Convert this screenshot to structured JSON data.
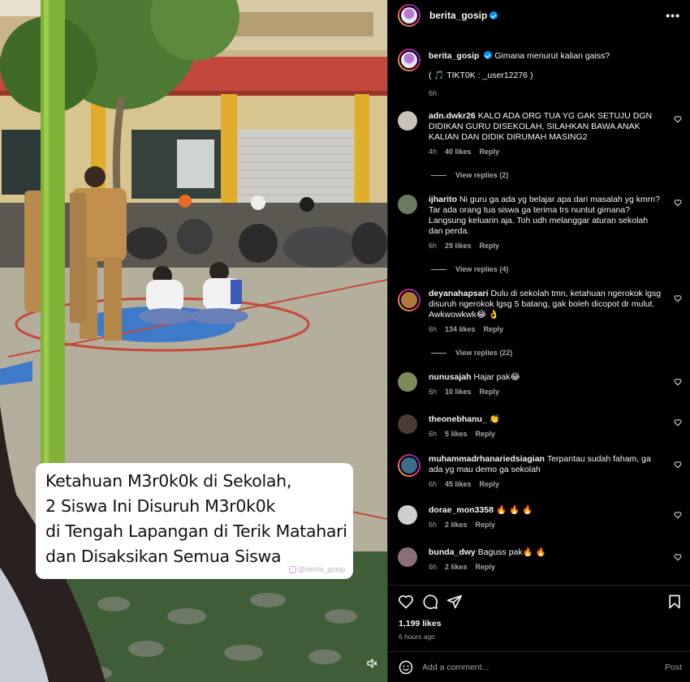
{
  "media": {
    "caption_lines": [
      "Ketahuan M3r0k0k di Sekolah,",
      "2 Siswa Ini Disuruh M3r0k0k",
      "di Tengah Lapangan di Terik Matahari",
      "dan Disaksikan Semua Siswa"
    ],
    "watermark": "@berita_gosip",
    "mute_icon": "speaker-muted-icon"
  },
  "post": {
    "username": "berita_gosip",
    "verified": true,
    "caption_user": "berita_gosip",
    "caption_text": "Gimana menurut kalian gaiss?",
    "caption_credit": "( 🎵 TIKT0K : _user12276 )",
    "caption_time": "6h",
    "more_icon": "more-options-icon"
  },
  "comments": [
    {
      "user": "adn.dwkr26",
      "text": "KALO ADA ORG TUA YG GAK SETUJU DGN DIDIKAN GURU DISEKOLAH, SILAHKAN BAWA ANAK KALIAN DAN DIDIK DIRUMAH MASING2",
      "time": "4h",
      "likes": "40 likes",
      "reply": "Reply",
      "view_replies": "View replies (2)",
      "avatar_color": "#c9c2b8"
    },
    {
      "user": "ijharito",
      "text": "Ni guru ga ada yg belajar apa dari masalah yg kmrn? Tar ada orang tua siswa ga terima trs nuntut gimana? Langsung keluarin aja. Toh udh melanggar aturan sekolah dan perda.",
      "time": "6h",
      "likes": "29 likes",
      "reply": "Reply",
      "view_replies": "View replies (4)",
      "avatar_color": "#6b7a5e"
    },
    {
      "user": "deyanahapsari",
      "text": "Dulu di sekolah tmn, ketahuan ngerokok lgsg disuruh ngerokok lgsg 5 batang, gak boleh dicopot dr mulut. Awkwowkwk😂 👌",
      "time": "6h",
      "likes": "134 likes",
      "reply": "Reply",
      "view_replies": "View replies (22)",
      "avatar_color": "#b07a3c"
    },
    {
      "user": "nunusajah",
      "text": "Hajar pak😂",
      "time": "6h",
      "likes": "10 likes",
      "reply": "Reply",
      "view_replies": "",
      "avatar_color": "#7d8a5a"
    },
    {
      "user": "theonebhanu_",
      "text": "👏",
      "time": "6h",
      "likes": "5 likes",
      "reply": "Reply",
      "view_replies": "",
      "avatar_color": "#4a3a34"
    },
    {
      "user": "muhammadrhanariedsiagian",
      "text": "Terpantau sudah faham, ga ada yg mau demo ga sekolah",
      "time": "6h",
      "likes": "45 likes",
      "reply": "Reply",
      "view_replies": "",
      "avatar_color": "#3c6e8c"
    },
    {
      "user": "dorae_mon3358",
      "text": "🔥 🔥 🔥",
      "time": "6h",
      "likes": "2 likes",
      "reply": "Reply",
      "view_replies": "",
      "avatar_color": "#cfcfcf"
    },
    {
      "user": "bunda_dwy",
      "text": "Baguss pak🔥 🔥",
      "time": "6h",
      "likes": "2 likes",
      "reply": "Reply",
      "view_replies": "",
      "avatar_color": "#8a6e7a"
    }
  ],
  "actions": {
    "icons": [
      "heart-icon",
      "comment-icon",
      "share-icon",
      "bookmark-icon"
    ],
    "likes": "1,199 likes",
    "time_ago": "6 hours ago",
    "add_comment_placeholder": "Add a comment...",
    "post_label": "Post",
    "emoji_icon": "emoji-icon"
  },
  "colors": {
    "background": "#000000",
    "text": "#f5f5f5",
    "muted": "#a8a8a8",
    "verified": "#0095f6",
    "divider": "#262626"
  }
}
